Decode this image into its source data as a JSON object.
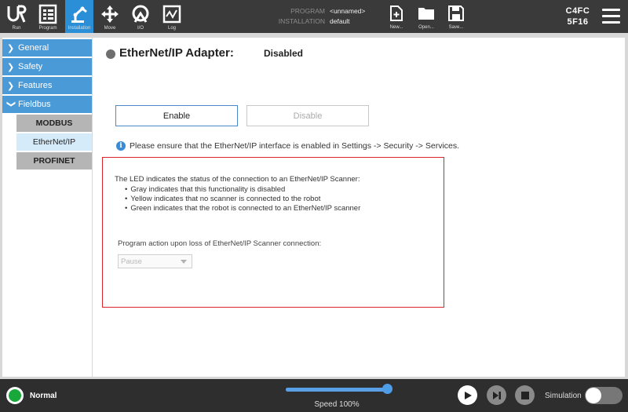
{
  "nav": [
    {
      "label": "Run",
      "icon": "ur-logo-icon"
    },
    {
      "label": "Program",
      "icon": "program-icon"
    },
    {
      "label": "Installation",
      "icon": "robot-arm-icon",
      "active": true
    },
    {
      "label": "Move",
      "icon": "move-arrows-icon"
    },
    {
      "label": "I/O",
      "icon": "io-icon"
    },
    {
      "label": "Log",
      "icon": "log-chart-icon"
    }
  ],
  "program_info": {
    "program_label": "PROGRAM",
    "program_value": "<unnamed>",
    "installation_label": "INSTALLATION",
    "installation_value": "default"
  },
  "file_buttons": [
    {
      "label": "New...",
      "icon": "new-file-icon"
    },
    {
      "label": "Open...",
      "icon": "folder-icon"
    },
    {
      "label": "Save...",
      "icon": "save-icon"
    }
  ],
  "robot_id": {
    "line1": "C4FC",
    "line2": "5F16"
  },
  "sidebar": {
    "items": [
      {
        "label": "General",
        "expanded": false
      },
      {
        "label": "Safety",
        "expanded": false
      },
      {
        "label": "Features",
        "expanded": false
      },
      {
        "label": "Fieldbus",
        "expanded": true
      }
    ],
    "subitems": [
      {
        "label": "MODBUS"
      },
      {
        "label": "EtherNet/IP",
        "selected": true
      },
      {
        "label": "PROFINET"
      }
    ]
  },
  "content": {
    "title": "EtherNet/IP Adapter:",
    "status": "Disabled",
    "enable_label": "Enable",
    "disable_label": "Disable",
    "info_text": "Please ensure that the EtherNet/IP interface is enabled in Settings -> Security -> Services.",
    "led_description": "The LED indicates the status of the connection to an EtherNet/IP Scanner:",
    "led_states": [
      "Gray indicates that this functionality is disabled",
      "Yellow indicates that no scanner is connected to the robot",
      "Green indicates that the robot is connected to an EtherNet/IP scanner"
    ],
    "action_label": "Program action upon loss of EtherNet/IP Scanner connection:",
    "action_value": "Pause"
  },
  "bottom": {
    "status": "Normal",
    "speed_text": "Speed 100%",
    "speed_fraction": 1.0,
    "simulation_label": "Simulation",
    "simulation_on": false
  },
  "colors": {
    "accent": "#2b8fd8",
    "highlight_box": "#d9232d",
    "status_ok": "#19a83a"
  }
}
